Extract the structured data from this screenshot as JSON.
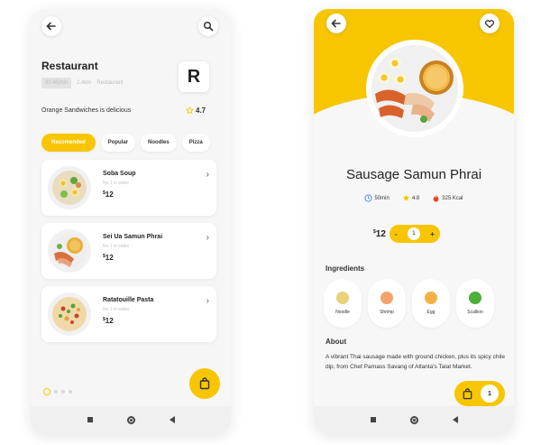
{
  "colors": {
    "accent": "#f7c600",
    "text": "#222222",
    "muted": "#bdbdbd"
  },
  "left": {
    "header": {
      "back_icon": "back-arrow-icon",
      "search_icon": "search-icon"
    },
    "restaurant": {
      "name": "Restaurant",
      "badge": "30-45min",
      "distance": "2.4km",
      "type": "Restaurant",
      "tagline": "Orange Sandwiches is delicious",
      "rating": "4.7",
      "logo": "R"
    },
    "categories": [
      {
        "label": "Recomended",
        "active": true
      },
      {
        "label": "Popular",
        "active": false
      },
      {
        "label": "Noodles",
        "active": false
      },
      {
        "label": "Pizza",
        "active": false
      }
    ],
    "items": [
      {
        "name": "Soba Soup",
        "sub": "No.1 in sales",
        "currency": "$",
        "price": "12"
      },
      {
        "name": "Sei Ua Samun Phrai",
        "sub": "No.1 in sales",
        "currency": "$",
        "price": "12"
      },
      {
        "name": "Ratatouille Pasta",
        "sub": "No.1 in sales",
        "currency": "$",
        "price": "12"
      }
    ],
    "pager": {
      "count": 4,
      "active": 0
    }
  },
  "right": {
    "dish": {
      "name": "Sausage Samun Phrai",
      "time": "50min",
      "rating": "4.8",
      "kcal": "325 Kcal",
      "currency": "$",
      "price": "12",
      "quantity": "1"
    },
    "ingredients_title": "Ingredients",
    "ingredients": [
      {
        "label": "Noodle",
        "color": "#e8d27a"
      },
      {
        "label": "Shrimp",
        "color": "#f3a36c"
      },
      {
        "label": "Egg",
        "color": "#f5b244"
      },
      {
        "label": "Scallion",
        "color": "#4caf3a"
      }
    ],
    "about_title": "About",
    "about_text": "A vibrant Thai sausage made with ground chicken, plus its spicy chile dip, from Chef Parnass Savang of Atlanta's Talat Market.",
    "cart_count": "1"
  }
}
